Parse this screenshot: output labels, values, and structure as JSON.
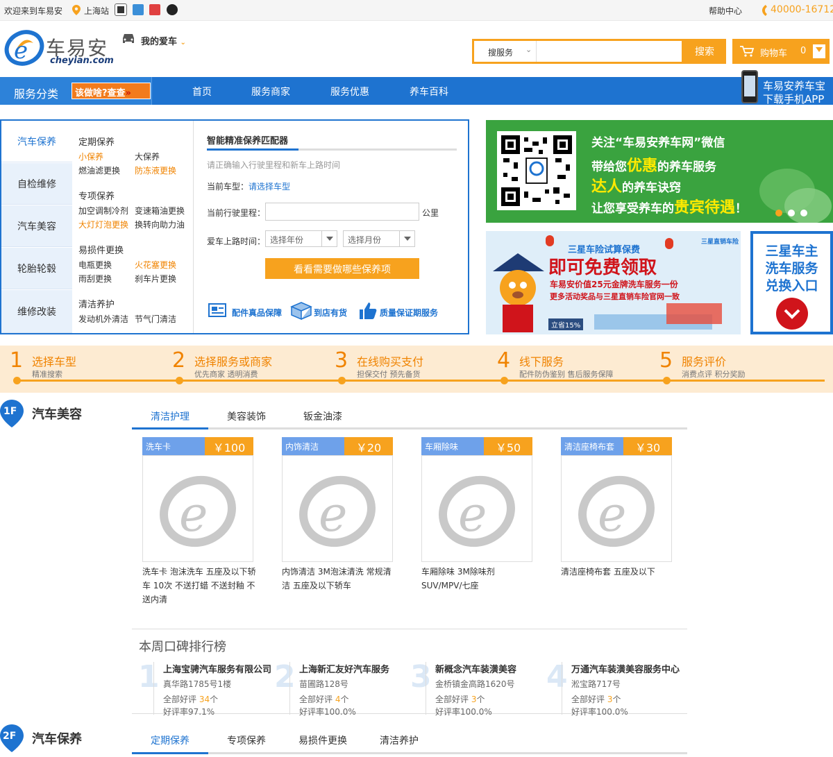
{
  "topbar": {
    "welcome": "欢迎来到车易安",
    "city": "上海站",
    "help": "帮助中心",
    "phone": "40000-16712"
  },
  "header": {
    "logo_cn": "车易安",
    "logo_en": "cheyian.com",
    "my_car": "我的爱车",
    "search_select": "搜服务",
    "search_placeholder": "",
    "search_button": "搜索",
    "cart_label": "购物车",
    "cart_count": "0"
  },
  "nav": {
    "category": "服务分类",
    "promo": "该做啥?查查",
    "items": [
      "首页",
      "服务商家",
      "服务优惠",
      "养车百科"
    ],
    "app_line1": "车易安养车宝",
    "app_line2": "下载手机APP"
  },
  "category": {
    "tabs": [
      "汽车保养",
      "自检维修",
      "汽车美容",
      "轮胎轮毂",
      "维修改装"
    ],
    "groups": [
      {
        "title": "定期保养",
        "links": [
          "小保养",
          "大保养",
          "燃油滤更换",
          "防冻液更换"
        ]
      },
      {
        "title": "专项保养",
        "links": [
          "加空调制冷剂",
          "变速箱油更换",
          "大灯灯泡更换",
          "换转向助力油"
        ]
      },
      {
        "title": "易损件更换",
        "links": [
          "电瓶更换",
          "火花塞更换",
          "雨刮更换",
          "刹车片更换"
        ]
      },
      {
        "title": "清洁养护",
        "links": [
          "发动机外清洁",
          "节气门清洁"
        ]
      }
    ]
  },
  "matcher": {
    "title": "智能精准保养匹配器",
    "hint": "请正确输入行驶里程和新车上路时间",
    "current_model_label": "当前车型：",
    "current_model_value": "请选择车型",
    "mileage_label": "当前行驶里程：",
    "mileage_unit": "公里",
    "date_label": "爱车上路时间：",
    "year_select": "选择年份",
    "month_select": "选择月份",
    "button": "看看需要做哪些保养项",
    "features": [
      "配件真品保障",
      "到店有货",
      "质量保证期服务"
    ]
  },
  "banner_wechat": {
    "line1": "关注“车易安养车网”微信",
    "line2a": "带给您",
    "line2b": "优惠",
    "line2c": "的养车服务",
    "line3a": "达人",
    "line3b": "的养车诀窍",
    "line4a": "让您享受养车的",
    "line4b": "贵宾待遇",
    "line4c": "！"
  },
  "banner_samsung": {
    "top": "三星车险试算保费",
    "big": "即可免费领取",
    "line1": "车易安价值25元金牌洗车服务一份",
    "line2": "更多活动奖品与三星直销车险官网一致",
    "badge": "立省15%",
    "brand": "三星直销车险"
  },
  "side_box": {
    "line1": "三星车主",
    "line2": "洗车服务",
    "line3": "兑换入口"
  },
  "steps": [
    {
      "num": "1",
      "title": "选择车型",
      "sub": "精准搜索"
    },
    {
      "num": "2",
      "title": "选择服务或商家",
      "sub": "优先商家 透明消费"
    },
    {
      "num": "3",
      "title": "在线购买支付",
      "sub": "担保交付 预先备货"
    },
    {
      "num": "4",
      "title": "线下服务",
      "sub": "配件防伪鉴别 售后服务保障"
    },
    {
      "num": "5",
      "title": "服务评价",
      "sub": "消费点评 积分奖励"
    }
  ],
  "floor1": {
    "badge": "1F",
    "title": "汽车美容",
    "tabs": [
      "清洁护理",
      "美容装饰",
      "钣金油漆"
    ],
    "products": [
      {
        "tag": "洗车卡",
        "price": "￥100",
        "desc": "洗车卡 泡沫洗车 五座及以下轿车 10次 不送打蜡 不送封釉 不送内清"
      },
      {
        "tag": "内饰清洁",
        "price": "￥20",
        "desc": "内饰清洁 3M泡沫清洗 常规清洁 五座及以下轿车"
      },
      {
        "tag": "车厢除味",
        "price": "￥50",
        "desc": "车厢除味 3M除味剂 SUV/MPV/七座"
      },
      {
        "tag": "清洁座椅布套",
        "price": "￥30",
        "desc": "清洁座椅布套 五座及以下"
      }
    ],
    "ranking_title": "本周口碑排行榜",
    "ranking": [
      {
        "num": "1",
        "name": "上海宝骋汽车服务有限公司",
        "addr": "真华路1785号1楼",
        "good_label": "全部好评",
        "good": "34",
        "unit": "个",
        "rate": "好评率97.1%"
      },
      {
        "num": "2",
        "name": "上海新汇友好汽车服务",
        "addr": "苗圃路128号",
        "good_label": "全部好评",
        "good": "4",
        "unit": "个",
        "rate": "好评率100.0%"
      },
      {
        "num": "3",
        "name": "新概念汽车装潢美容",
        "addr": "金桥镇金高路1620号",
        "good_label": "全部好评",
        "good": "3",
        "unit": "个",
        "rate": "好评率100.0%"
      },
      {
        "num": "4",
        "name": "万通汽车装潢美容服务中心",
        "addr": "淞宝路717号",
        "good_label": "全部好评",
        "good": "3",
        "unit": "个",
        "rate": "好评率100.0%"
      }
    ]
  },
  "floor2": {
    "badge": "2F",
    "title": "汽车保养",
    "tabs": [
      "定期保养",
      "专项保养",
      "易损件更换",
      "清洁养护"
    ]
  },
  "colors": {
    "brand_blue": "#1e73d0",
    "accent_orange": "#f7a21e",
    "wechat_green": "#3aa33f"
  }
}
